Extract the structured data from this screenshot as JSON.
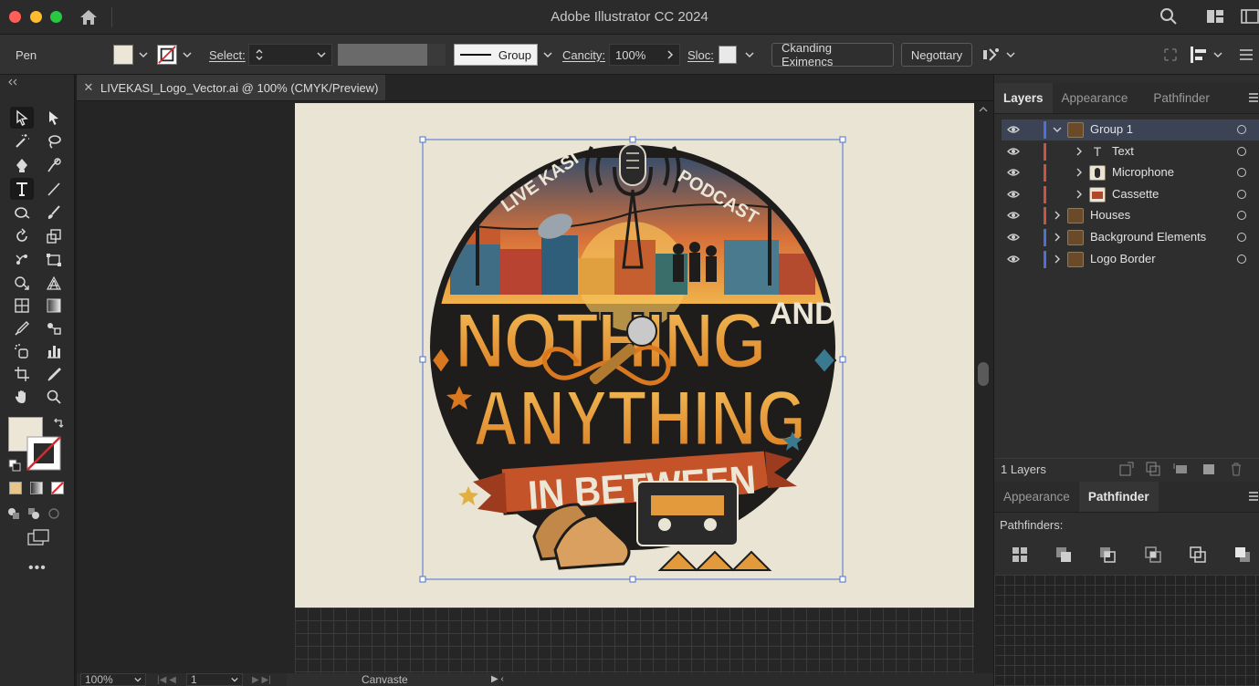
{
  "window": {
    "title": "Adobe Illustrator CC 2024"
  },
  "controlbar": {
    "tool_name": "Pen",
    "select_label": "Select:",
    "stroke_style_value": "Group",
    "opacity_label": "Cancity:",
    "opacity_value": "100%",
    "style_label": "Sloc:",
    "button1": "Ckanding Eximencs",
    "button2": "Negottary"
  },
  "document": {
    "tab_title": "LIVEKASI_Logo_Vector.ai @ 100% (CMYK/Preview)",
    "logo": {
      "arc_left": "LIVE KASI",
      "arc_right": "PODCAST",
      "line1": "NOTHING",
      "line1_small": "AND",
      "line2": "ANYTHING",
      "banner": "IN BETWEEN"
    }
  },
  "statusbar": {
    "zoom": "100%",
    "artboard_index": "1",
    "artboard_name": "Canvaste"
  },
  "layers_panel": {
    "tabs": [
      "Layers",
      "Appearance",
      "Pathfinder"
    ],
    "active_tab": "Layers",
    "rows": [
      {
        "name": "Group 1",
        "color": "#4d6fd6",
        "selected": true,
        "expanded": true,
        "indent": 0,
        "thumb": "logo"
      },
      {
        "name": "Text",
        "color": "#c9553f",
        "selected": false,
        "expanded": false,
        "indent": 1,
        "thumb": "type"
      },
      {
        "name": "Microphone",
        "color": "#c9553f",
        "selected": false,
        "expanded": false,
        "indent": 1,
        "thumb": "mic"
      },
      {
        "name": "Cassette",
        "color": "#c9553f",
        "selected": false,
        "expanded": false,
        "indent": 1,
        "thumb": "cassette"
      },
      {
        "name": "Houses",
        "color": "#c9553f",
        "selected": false,
        "expanded": false,
        "indent": 0,
        "thumb": "logo"
      },
      {
        "name": "Background Elements",
        "color": "#4d6fd6",
        "selected": false,
        "expanded": false,
        "indent": 0,
        "thumb": "logo"
      },
      {
        "name": "Logo Border",
        "color": "#4d6fd6",
        "selected": false,
        "expanded": false,
        "indent": 0,
        "thumb": "logo"
      }
    ],
    "footer_count": "1 Layers"
  },
  "pathfinder_panel": {
    "tabs": [
      "Appearance",
      "Pathfinder"
    ],
    "active_tab": "Pathfinder",
    "label": "Pathfinders:"
  },
  "colors": {
    "artboard_bg": "#e9e4d4",
    "selection_blue": "#4d6fd6",
    "accent_orange": "#e59a2e",
    "dark_ink": "#1f1d1b"
  }
}
